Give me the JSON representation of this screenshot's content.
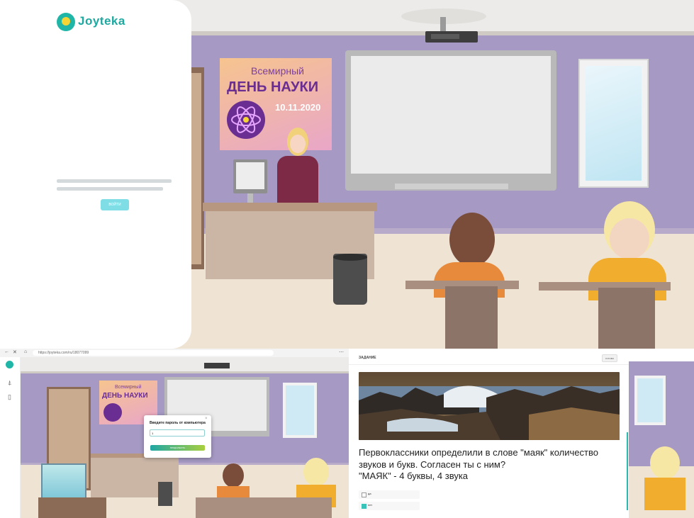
{
  "login": {
    "logo_text": "Joyteka",
    "logo_icon": "bulb-icon",
    "button_label": "ВОЙТИ"
  },
  "poster": {
    "line1": "Всемирный",
    "line2": "ДЕНЬ НАУКИ",
    "date": "10.11.2020",
    "icon": "atom-icon"
  },
  "browser": {
    "url": "https://joyteka.com/ru/18077099"
  },
  "password_modal": {
    "title": "Введите пароль от компьютера",
    "input_value": "1",
    "button_label": "ПРОДОЛЖИТЬ"
  },
  "task": {
    "header": "ЗАДАНИЕ",
    "ready_label": "ГОТОВО",
    "question_line1": "Первоклассники определили в слове \"маяк\" количество",
    "question_line2": "звуков и букв. Согласен ты с ним?",
    "question_line3": "\"МАЯК\" - 4 буквы, 4 звука",
    "options": [
      {
        "label": "да",
        "selected": false
      },
      {
        "label": "нет",
        "selected": true
      }
    ]
  },
  "colors": {
    "wall": "#a69ac4",
    "floor": "#efe3d3",
    "brand_teal": "#1fa8a0",
    "button_teal": "#7fdde6",
    "poster_purple": "#6a2d91"
  }
}
